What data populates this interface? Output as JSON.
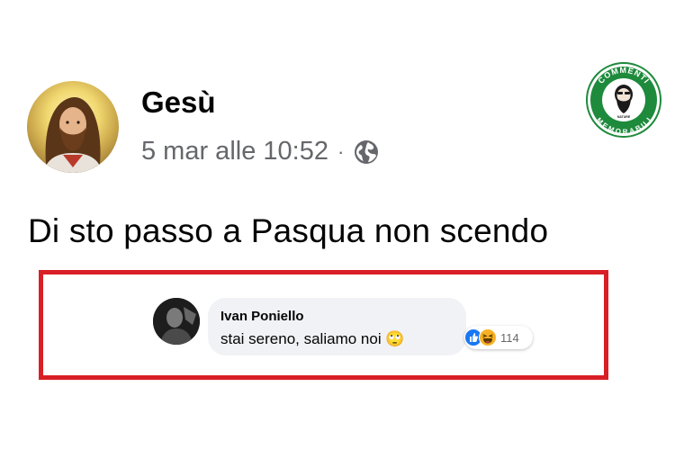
{
  "post": {
    "author": "Gesù",
    "timestamp": "5 mar alle 10:52",
    "separator": "·",
    "privacy_icon": "globe-icon",
    "text": "Di sto passo a Pasqua non scendo"
  },
  "logo": {
    "top_text": "COMMENTI",
    "bottom_text": "MEMORABILI",
    "small_text": "NATURE",
    "brand_color": "#1e8a3c"
  },
  "comment": {
    "author": "Ivan Poniello",
    "text": "stai sereno, saliamo noi",
    "emoji": "🙄",
    "reactions": {
      "icons": [
        "like-icon",
        "haha-icon"
      ],
      "count": "114"
    }
  },
  "colors": {
    "highlight_border": "#d91f26",
    "bubble_bg": "#f0f2f5",
    "meta_text": "#65676b",
    "like_blue": "#1877f2"
  }
}
